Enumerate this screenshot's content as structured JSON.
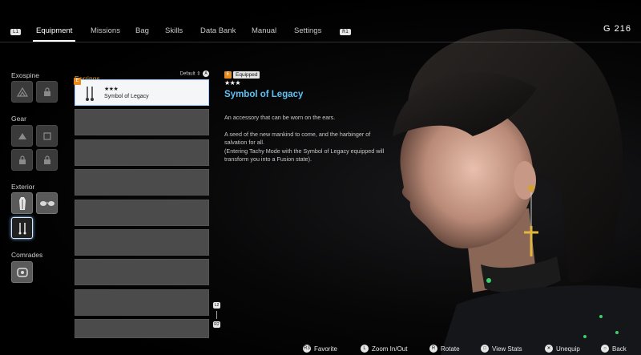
{
  "nav": {
    "left_chip": "L1",
    "right_chip": "R1",
    "tabs": [
      "Equipment",
      "Missions",
      "Bag",
      "Skills",
      "Data Bank",
      "Manual",
      "Settings"
    ],
    "currency": "G  216"
  },
  "categories": {
    "exospine": "Exospine",
    "gear": "Gear",
    "exterior": "Exterior",
    "comrades": "Comrades"
  },
  "list": {
    "title": "Earrings",
    "sort_label": "Default",
    "sort_button": "A",
    "items": [
      {
        "badge": "E",
        "stars": "★★★",
        "name": "Symbol of Legacy"
      }
    ],
    "scroll_up": "L2",
    "scroll_down": "R2"
  },
  "detail": {
    "badge": "E",
    "status": "Equipped",
    "stars": "★★★",
    "title": "Symbol of Legacy",
    "description_1": "An accessory that can be worn on the ears.",
    "description_2": "A seed of the new mankind to come, and the harbinger of salvation for all.",
    "description_3": "(Entering Tachy Mode with the Symbol of Legacy equipped will transform you into a Fusion state)."
  },
  "prompts": [
    {
      "icon": "R3",
      "label": "Favorite"
    },
    {
      "icon": "L",
      "label": "Zoom In/Out"
    },
    {
      "icon": "R",
      "label": "Rotate"
    },
    {
      "icon": "□",
      "label": "View Stats"
    },
    {
      "icon": "✕",
      "label": "Unequip"
    },
    {
      "icon": "○",
      "label": "Back"
    }
  ],
  "colors": {
    "accent_title": "#5fc2f5",
    "list_header": "#e8a23b",
    "equipped_badge": "#e88a1c"
  }
}
